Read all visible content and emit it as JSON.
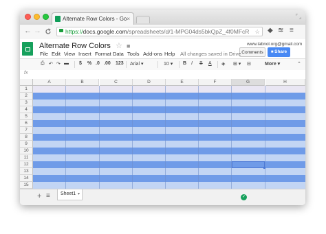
{
  "browser": {
    "tab_title": "Alternate Row Colors - Go",
    "tab_close": "×",
    "url_scheme": "https://",
    "url_host": "docs.google.com",
    "url_path": "/spreadsheets/d/1-MPG04ds5bkQpZ_4f0MFcR",
    "back": "←",
    "forward": "→",
    "reload": "C",
    "star": "☆",
    "menu_icon": "≡"
  },
  "app": {
    "doc_title": "Alternate Row Colors",
    "star": "☆",
    "email": "www.labnol.org@gmail.com",
    "comments_label": "Comments",
    "share_label": "Share",
    "saved_status": "All changes saved in Drive",
    "menu": [
      "File",
      "Edit",
      "View",
      "Insert",
      "Format",
      "Data",
      "Tools",
      "Add-ons",
      "Help"
    ]
  },
  "toolbar": {
    "currency": "$",
    "percent": "%",
    "decimals_less": ".0",
    "decimals_more": ".00",
    "number_format": "123",
    "font": "Arial",
    "size": "10",
    "bold": "B",
    "italic": "I",
    "strike": "S",
    "text_color": "A",
    "more": "More"
  },
  "formula": {
    "fx": "fx"
  },
  "grid": {
    "columns": [
      "A",
      "B",
      "C",
      "D",
      "E",
      "F",
      "G",
      "H"
    ],
    "rows": [
      "1",
      "2",
      "3",
      "4",
      "5",
      "6",
      "7",
      "8",
      "9",
      "10",
      "11",
      "12",
      "13",
      "14",
      "15"
    ],
    "header_color": "#e9e6f3",
    "odd_row_color": "#6f9be8",
    "even_row_color": "#c2d5f4",
    "selected_cell": "G12"
  },
  "sheets": {
    "add": "+",
    "list": "≡",
    "active_tab": "Sheet1",
    "tab_arrow": "▾",
    "status_icon": "✓"
  }
}
